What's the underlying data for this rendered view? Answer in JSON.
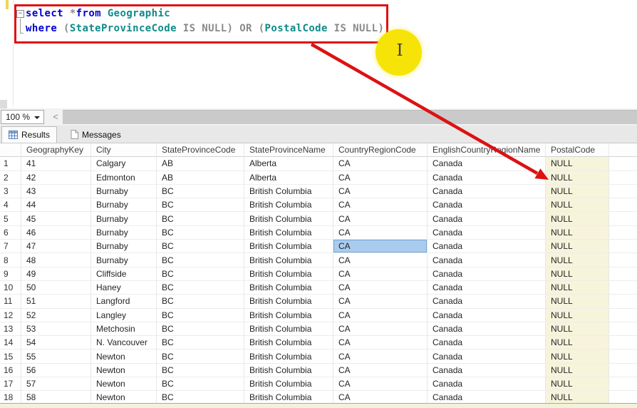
{
  "editor": {
    "fold_glyph": "−",
    "line1_tokens": [
      {
        "t": "select ",
        "c": "kw"
      },
      {
        "t": "*",
        "c": "gr"
      },
      {
        "t": "from",
        "c": "kw"
      },
      {
        "t": " ",
        "c": "gr"
      },
      {
        "t": "Geographic",
        "c": "id"
      }
    ],
    "line2_tokens": [
      {
        "t": "where ",
        "c": "kw"
      },
      {
        "t": "(",
        "c": "gr"
      },
      {
        "t": "StateProvinceCode",
        "c": "id"
      },
      {
        "t": " IS NULL) OR (",
        "c": "gr"
      },
      {
        "t": "PostalCode",
        "c": "id"
      },
      {
        "t": " IS NULL)",
        "c": "gr"
      }
    ]
  },
  "annotations": {
    "highlight_box_color": "#dd1111",
    "arrow_color": "#dd1111",
    "spotlight_color": "#f6e409",
    "cursor_glyph": "I"
  },
  "toolbar": {
    "zoom_value": "100 %",
    "scroll_left_glyph": "<"
  },
  "tabs": [
    {
      "label": "Results",
      "active": true
    },
    {
      "label": "Messages",
      "active": false
    }
  ],
  "grid": {
    "columns": [
      "GeographyKey",
      "City",
      "StateProvinceCode",
      "StateProvinceName",
      "CountryRegionCode",
      "EnglishCountryRegionName",
      "PostalCode"
    ],
    "rows": [
      {
        "n": 1,
        "v": [
          "41",
          "Calgary",
          "AB",
          "Alberta",
          "CA",
          "Canada",
          "NULL"
        ]
      },
      {
        "n": 2,
        "v": [
          "42",
          "Edmonton",
          "AB",
          "Alberta",
          "CA",
          "Canada",
          "NULL"
        ]
      },
      {
        "n": 3,
        "v": [
          "43",
          "Burnaby",
          "BC",
          "British Columbia",
          "CA",
          "Canada",
          "NULL"
        ]
      },
      {
        "n": 4,
        "v": [
          "44",
          "Burnaby",
          "BC",
          "British Columbia",
          "CA",
          "Canada",
          "NULL"
        ]
      },
      {
        "n": 5,
        "v": [
          "45",
          "Burnaby",
          "BC",
          "British Columbia",
          "CA",
          "Canada",
          "NULL"
        ]
      },
      {
        "n": 6,
        "v": [
          "46",
          "Burnaby",
          "BC",
          "British Columbia",
          "CA",
          "Canada",
          "NULL"
        ]
      },
      {
        "n": 7,
        "v": [
          "47",
          "Burnaby",
          "BC",
          "British Columbia",
          "CA",
          "Canada",
          "NULL"
        ]
      },
      {
        "n": 8,
        "v": [
          "48",
          "Burnaby",
          "BC",
          "British Columbia",
          "CA",
          "Canada",
          "NULL"
        ]
      },
      {
        "n": 9,
        "v": [
          "49",
          "Cliffside",
          "BC",
          "British Columbia",
          "CA",
          "Canada",
          "NULL"
        ]
      },
      {
        "n": 10,
        "v": [
          "50",
          "Haney",
          "BC",
          "British Columbia",
          "CA",
          "Canada",
          "NULL"
        ]
      },
      {
        "n": 11,
        "v": [
          "51",
          "Langford",
          "BC",
          "British Columbia",
          "CA",
          "Canada",
          "NULL"
        ]
      },
      {
        "n": 12,
        "v": [
          "52",
          "Langley",
          "BC",
          "British Columbia",
          "CA",
          "Canada",
          "NULL"
        ]
      },
      {
        "n": 13,
        "v": [
          "53",
          "Metchosin",
          "BC",
          "British Columbia",
          "CA",
          "Canada",
          "NULL"
        ]
      },
      {
        "n": 14,
        "v": [
          "54",
          "N. Vancouver",
          "BC",
          "British Columbia",
          "CA",
          "Canada",
          "NULL"
        ]
      },
      {
        "n": 15,
        "v": [
          "55",
          "Newton",
          "BC",
          "British Columbia",
          "CA",
          "Canada",
          "NULL"
        ]
      },
      {
        "n": 16,
        "v": [
          "56",
          "Newton",
          "BC",
          "British Columbia",
          "CA",
          "Canada",
          "NULL"
        ]
      },
      {
        "n": 17,
        "v": [
          "57",
          "Newton",
          "BC",
          "British Columbia",
          "CA",
          "Canada",
          "NULL"
        ]
      },
      {
        "n": 18,
        "v": [
          "58",
          "Newton",
          "BC",
          "British Columbia",
          "CA",
          "Canada",
          "NULL"
        ]
      }
    ],
    "selected_cell": {
      "row": 7,
      "col": 4
    },
    "null_cell_color": "#f7f4dc",
    "selection_color": "#a9ccee"
  }
}
